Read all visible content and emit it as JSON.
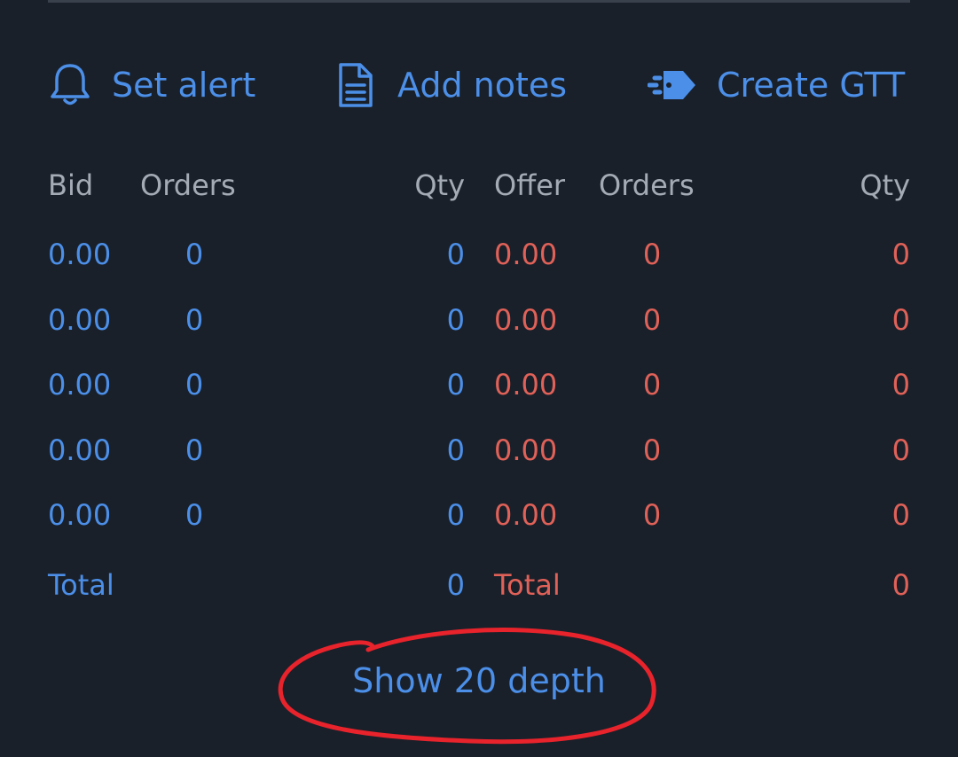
{
  "actions": {
    "set_alert": "Set alert",
    "add_notes": "Add notes",
    "create_gtt": "Create GTT"
  },
  "headers": {
    "bid": "Bid",
    "bid_orders": "Orders",
    "bid_qty": "Qty",
    "offer": "Offer",
    "offer_orders": "Orders",
    "offer_qty": "Qty"
  },
  "rows": [
    {
      "bid": "0.00",
      "bid_orders": "0",
      "bid_qty": "0",
      "offer": "0.00",
      "offer_orders": "0",
      "offer_qty": "0"
    },
    {
      "bid": "0.00",
      "bid_orders": "0",
      "bid_qty": "0",
      "offer": "0.00",
      "offer_orders": "0",
      "offer_qty": "0"
    },
    {
      "bid": "0.00",
      "bid_orders": "0",
      "bid_qty": "0",
      "offer": "0.00",
      "offer_orders": "0",
      "offer_qty": "0"
    },
    {
      "bid": "0.00",
      "bid_orders": "0",
      "bid_qty": "0",
      "offer": "0.00",
      "offer_orders": "0",
      "offer_qty": "0"
    },
    {
      "bid": "0.00",
      "bid_orders": "0",
      "bid_qty": "0",
      "offer": "0.00",
      "offer_orders": "0",
      "offer_qty": "0"
    }
  ],
  "totals": {
    "bid_label": "Total",
    "bid_qty": "0",
    "offer_label": "Total",
    "offer_qty": "0"
  },
  "show_depth": "Show 20 depth",
  "colors": {
    "background": "#19202a",
    "accent_blue": "#4c8fe8",
    "offer_red": "#e06158",
    "header_gray": "#a4abb5",
    "annotation_red": "#e8232b"
  },
  "icons": [
    "bell-icon",
    "document-icon",
    "gtt-arrow-icon"
  ]
}
